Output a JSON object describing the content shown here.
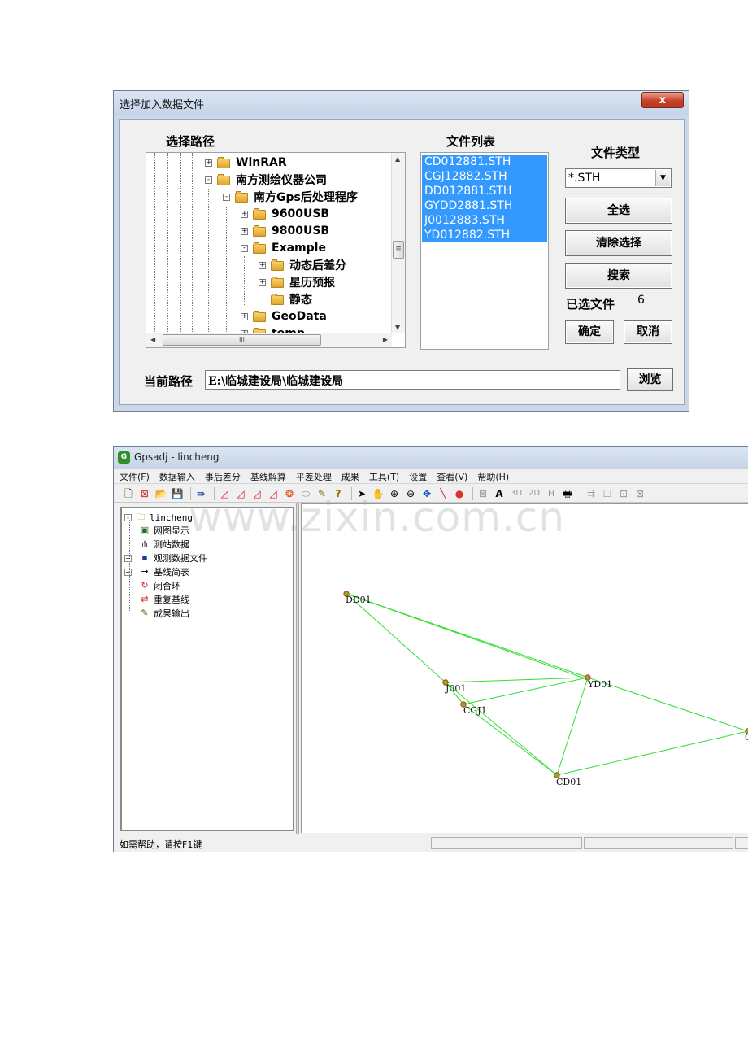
{
  "dialog": {
    "title": "选择加入数据文件",
    "close_label": "x",
    "select_path_label": "选择路径",
    "file_list_label": "文件列表",
    "file_type_label": "文件类型",
    "file_type_value": "*.STH",
    "tree": [
      {
        "label": "WinRAR",
        "expander": "+"
      },
      {
        "label": "南方测绘仪器公司",
        "expander": "-"
      },
      {
        "label": "南方Gps后处理程序",
        "expander": "-"
      },
      {
        "label": "9600USB",
        "expander": "+"
      },
      {
        "label": "9800USB",
        "expander": "+"
      },
      {
        "label": "Example",
        "expander": "-"
      },
      {
        "label": "动态后差分",
        "expander": "+"
      },
      {
        "label": "星历预报",
        "expander": "+"
      },
      {
        "label": "静态",
        "expander": ""
      },
      {
        "label": "GeoData",
        "expander": "+"
      },
      {
        "label": "temp",
        "expander": "+"
      }
    ],
    "files": [
      "CD012881.STH",
      "CGJ12882.STH",
      "DD012881.STH",
      "GYDD2881.STH",
      "J0012883.STH",
      "YD012882.STH"
    ],
    "btn_select_all": "全选",
    "btn_clear_selection": "清除选择",
    "btn_search": "搜索",
    "selected_files_label": "已选文件",
    "selected_files_count": "6",
    "btn_ok": "确定",
    "btn_cancel": "取消",
    "current_path_label": "当前路径",
    "current_path_value": "E:\\临城建设局\\临城建设局",
    "btn_browse": "浏览"
  },
  "app": {
    "icon_label": "G",
    "title": "Gpsadj - lincheng",
    "menu": [
      "文件(F)",
      "数据输入",
      "事后差分",
      "基线解算",
      "平差处理",
      "成果",
      "工具(T)",
      "设置",
      "查看(V)",
      "帮助(H)"
    ],
    "tree_root": "lincheng",
    "tree_root_expander": "-",
    "tree_items": [
      {
        "label": "网图显示",
        "icon": "image-icon",
        "expander": ""
      },
      {
        "label": "测站数据",
        "icon": "tripod-icon",
        "expander": ""
      },
      {
        "label": "观测数据文件",
        "icon": "disk-icon",
        "expander": "+"
      },
      {
        "label": "基线简表",
        "icon": "arrow-icon",
        "expander": "+"
      },
      {
        "label": "闭合环",
        "icon": "loop-icon",
        "expander": ""
      },
      {
        "label": "重复基线",
        "icon": "repeat-icon",
        "expander": ""
      },
      {
        "label": "成果输出",
        "icon": "pen-icon",
        "expander": ""
      }
    ],
    "toolbar_texts": {
      "a": "A",
      "three_d": "3D",
      "two_d": "2D",
      "h": "H"
    },
    "stations": [
      {
        "name": "DD01"
      },
      {
        "name": "J001"
      },
      {
        "name": "YD01"
      },
      {
        "name": "CGJ1"
      },
      {
        "name": "CD01"
      },
      {
        "name": "G"
      }
    ],
    "status_help": "如需帮助，请按F1键"
  },
  "watermark": "www.zixin.com.cn",
  "colors": {
    "selection": "#3399ff",
    "baseline": "#33dd33",
    "station": "#7fb51e"
  }
}
